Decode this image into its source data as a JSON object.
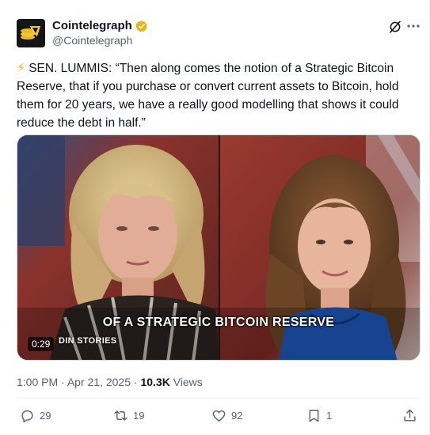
{
  "author": {
    "display_name": "Cointelegraph",
    "handle": "@Cointelegraph",
    "verified": true,
    "verified_color": "#e2b719"
  },
  "tweet": {
    "text_prefix_emoji": "⚡",
    "text": "SEN. LUMMIS: “Then along comes the notion of a Strategic Bitcoin Reserve, that if you purchase or convert current assets to Bitcoin, hold them for 20 years, we have a really good modelling that shows it could reduce the debt in half.”"
  },
  "media": {
    "caption_main": "OF A STRATEGIC BITCOIN RESERVE",
    "caption_sub": "DIN STORIES",
    "duration": "0:29"
  },
  "meta": {
    "time": "1:00 PM",
    "separator": "·",
    "date": "Apr 21, 2025",
    "separator2": "·",
    "views_count": "10.3K",
    "views_label": "Views"
  },
  "actions": {
    "reply_count": "29",
    "retweet_count": "19",
    "like_count": "92",
    "bookmark_count": "1"
  },
  "icons": {
    "grok": "grok-icon",
    "more": "more-icon",
    "reply": "reply-icon",
    "retweet": "retweet-icon",
    "like": "heart-icon",
    "bookmark": "bookmark-icon",
    "share": "share-icon"
  },
  "colors": {
    "text_primary": "#0f1419",
    "text_secondary": "#536471",
    "divider": "#eff3f4"
  }
}
